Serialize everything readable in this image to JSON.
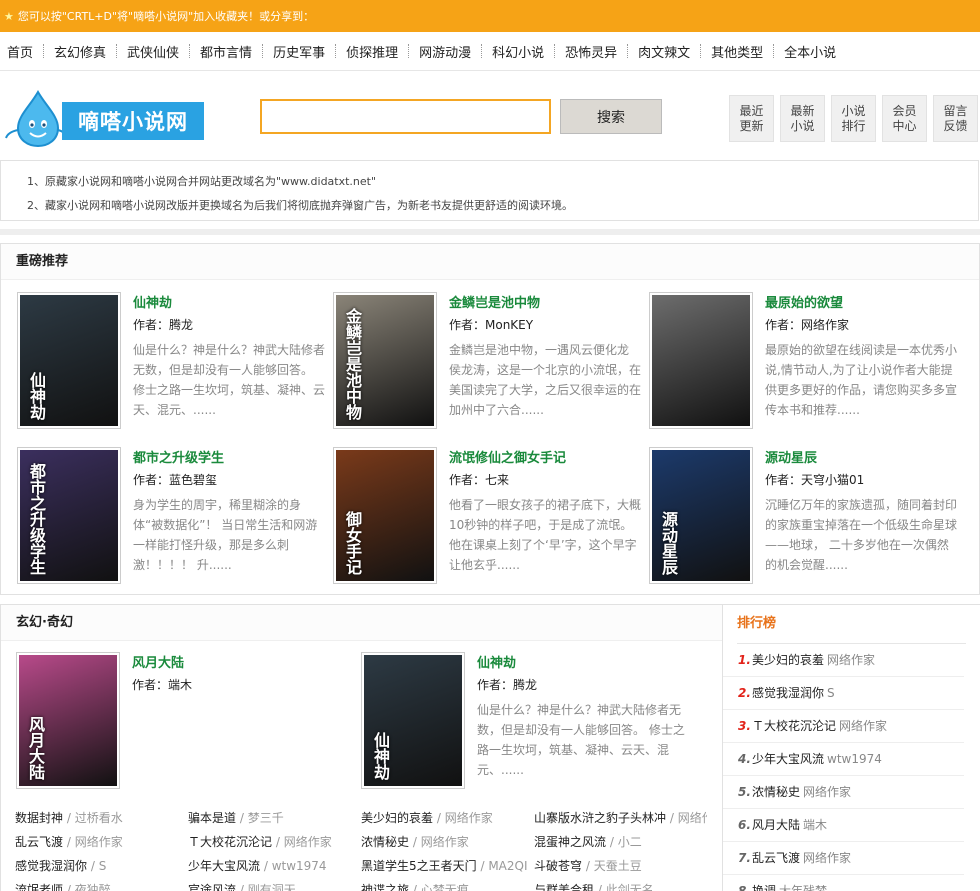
{
  "topbar": {
    "message": "您可以按\"CRTL+D\"将\"嘀嗒小说网\"加入收藏夹！或分享到："
  },
  "nav": [
    "首页",
    "玄幻修真",
    "武侠仙侠",
    "都市言情",
    "历史军事",
    "侦探推理",
    "网游动漫",
    "科幻小说",
    "恐怖灵异",
    "肉文辣文",
    "其他类型",
    "全本小说"
  ],
  "header": {
    "logo_text": "嘀嗒小说网",
    "search_placeholder": "",
    "search_button": "搜索",
    "quick_links": [
      "最近更新",
      "最新小说",
      "小说排行",
      "会员中心",
      "留言反馈"
    ]
  },
  "notice": [
    "1、原藏家小说网和嘀嗒小说网合并网站更改域名为\"www.didatxt.net\"",
    "2、藏家小说网和嘀嗒小说网改版并更换域名为后我们将彻底抛弃弹窗广告，为新老书友提供更舒适的阅读环境。"
  ],
  "featured": {
    "title": "重磅推荐",
    "books": [
      {
        "title": "仙神劫",
        "author": "作者：腾龙",
        "desc": "仙是什么？神是什么？神武大陆修者无数，但是却没有一人能够回答。 修士之路一生坎坷，筑基、凝神、云天、混元、......",
        "cover_text": "仙神劫",
        "cover_color": "#2d3a44"
      },
      {
        "title": "金鳞岂是池中物",
        "author": "作者：MonKEY",
        "desc": "金鳞岂是池中物，一遇风云便化龙 侯龙涛，这是一个北京的小流氓，在美国读完了大学，之后又很幸运的在加州中了六合......",
        "cover_text": "金鳞岂是池中物",
        "cover_color": "#8a8478"
      },
      {
        "title": "最原始的欲望",
        "author": "作者：网络作家",
        "desc": "最原始的欲望在线阅读是一本优秀小说,情节动人,为了让小说作者大能提供更多更好的作品，请您购买多多宣传本书和推荐......",
        "cover_text": "",
        "cover_color": "#6d6d6d"
      },
      {
        "title": "都市之升级学生",
        "author": "作者：蓝色碧玺",
        "desc": "身为学生的周宇，稀里糊涂的身体“被数据化”！ 当日常生活和网游一样能打怪升级，那是多么刺激！！！！ 升......",
        "cover_text": "都市之升级学生",
        "cover_color": "#3b2f5e"
      },
      {
        "title": "流氓修仙之御女手记",
        "author": "作者：七来",
        "desc": "他看了一眼女孩子的裙子底下，大概10秒钟的样子吧，于是成了流氓。 他在课桌上刻了个‘早’字，这个早字让他玄乎......",
        "cover_text": "御女手记",
        "cover_color": "#7a3a1a"
      },
      {
        "title": "源动星辰",
        "author": "作者：天穹小猫01",
        "desc": "沉睡亿万年的家族遗孤，随同着封印的家族重宝掉落在一个低级生命星球——地球， 二十多岁他在一次偶然的机会觉醒......",
        "cover_text": "源动星辰",
        "cover_color": "#1c3a6b"
      }
    ]
  },
  "xuanhuan": {
    "title": "玄幻·奇幻",
    "books": [
      {
        "title": "风月大陆",
        "author": "作者：端木",
        "desc": "",
        "cover_text": "风月大陆",
        "cover_color": "#b84a8a"
      },
      {
        "title": "仙神劫",
        "author": "作者：腾龙",
        "desc": "仙是什么？神是什么？神武大陆修者无数，但是却没有一人能够回答。 修士之路一生坎坷，筑基、凝神、云天、混元、......",
        "cover_text": "仙神劫",
        "cover_color": "#2d3a44"
      }
    ],
    "links": [
      [
        [
          "数据封神",
          "过桥看水"
        ],
        [
          "骗本是道",
          "梦三千"
        ],
        [
          "美少妇的哀羞",
          "网络作家"
        ],
        [
          "山寨版水浒之豹子头林冲",
          "网络作"
        ]
      ],
      [
        [
          "乱云飞渡",
          "网络作家"
        ],
        [
          "Ｔ大校花沉沦记",
          "网络作家"
        ],
        [
          "浓情秘史",
          "网络作家"
        ],
        [
          "混蛋神之风流",
          "小二"
        ]
      ],
      [
        [
          "感觉我湿润你",
          "S"
        ],
        [
          "少年大宝风流",
          "wtw1974"
        ],
        [
          "黑道学生5之王者天门",
          "MA2QI"
        ],
        [
          "斗破苍穹",
          "天蚕土豆"
        ]
      ],
      [
        [
          "流氓老师",
          "夜独醉"
        ],
        [
          "官途风流",
          "刚有洞天"
        ],
        [
          "神谍之旅",
          "心梦无痕"
        ],
        [
          "与群美合租",
          "此剑无名"
        ]
      ]
    ]
  },
  "rank": {
    "title": "排行榜",
    "items": [
      {
        "no": "1.",
        "name": "美少妇的哀羞",
        "author": "网络作家"
      },
      {
        "no": "2.",
        "name": "感觉我湿润你",
        "author": "S"
      },
      {
        "no": "3.",
        "name": "Ｔ大校花沉沦记",
        "author": "网络作家"
      },
      {
        "no": "4.",
        "name": "少年大宝风流",
        "author": "wtw1974"
      },
      {
        "no": "5.",
        "name": "浓情秘史",
        "author": "网络作家"
      },
      {
        "no": "6.",
        "name": "风月大陆",
        "author": "端木"
      },
      {
        "no": "7.",
        "name": "乱云飞渡",
        "author": "网络作家"
      },
      {
        "no": "8.",
        "name": "换调",
        "author": "大年残梦"
      }
    ]
  }
}
